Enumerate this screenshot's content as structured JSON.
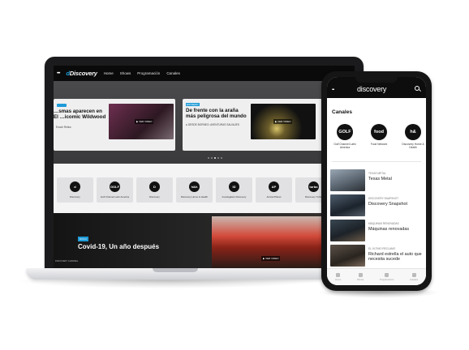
{
  "laptop": {
    "nav": {
      "menu_icon": "menu-dots-icon",
      "logo": "Discovery",
      "items": [
        "Home",
        "Shows",
        "Programación",
        "Canales"
      ]
    },
    "hero_cards": [
      {
        "badge": "",
        "title": "…smas aparecen en El …icomic Wildwood",
        "subtitle": "Enoch Relics",
        "cta": "VER VIDEO"
      },
      {
        "badge": "ESTRENO",
        "title": "De frente con la araña más peligrosa del mundo",
        "subtitle": "DESDE BORNEO: AVENTURAS SALVAJES",
        "cta": "VER VIDEO"
      }
    ],
    "channels": [
      {
        "logo": "d",
        "name": "Discovery"
      },
      {
        "logo": "GOLF",
        "name": "Golf Channel Latin America"
      },
      {
        "logo": "D",
        "name": "Discovery"
      },
      {
        "logo": "h&h",
        "name": "Discovery Home & Health"
      },
      {
        "logo": "ID",
        "name": "Investigation Discovery"
      },
      {
        "logo": "AP",
        "name": "Animal Planet"
      },
      {
        "logo": "turbo",
        "name": "Discovery Turbo"
      }
    ],
    "feature": {
      "badge": "DOCU",
      "title": "Covid-19, Un año después",
      "cta": "VER VIDEO",
      "tag": "DISCOVERY CHANNEL"
    }
  },
  "phone": {
    "logo": "discovery",
    "section_title": "Canales",
    "channels": [
      {
        "logo": "GOLF",
        "name": "Golf Channel Latin America"
      },
      {
        "logo": "food",
        "name": "Food Network"
      },
      {
        "logo": "h&",
        "name": "Discovery Home & Health"
      }
    ],
    "items": [
      {
        "tag": "TEXAS METAL",
        "title": "Texas Metal"
      },
      {
        "tag": "DISCOVERY SNAPSHOT",
        "title": "Discovery Snapshot"
      },
      {
        "tag": "MÁQUINAS RENOVADAS",
        "title": "Máquinas renovadas"
      },
      {
        "tag": "EL ÚLTIMO RECLAMO",
        "title": "Richard estrella el auto que necesita sucede"
      }
    ],
    "tabbar": [
      "Home",
      "Shows",
      "Programación",
      "Canales"
    ]
  },
  "colors": {
    "accent": "#1e9bd7",
    "nav_bg": "#0a0a0a",
    "card_bg": "#efeff0"
  }
}
